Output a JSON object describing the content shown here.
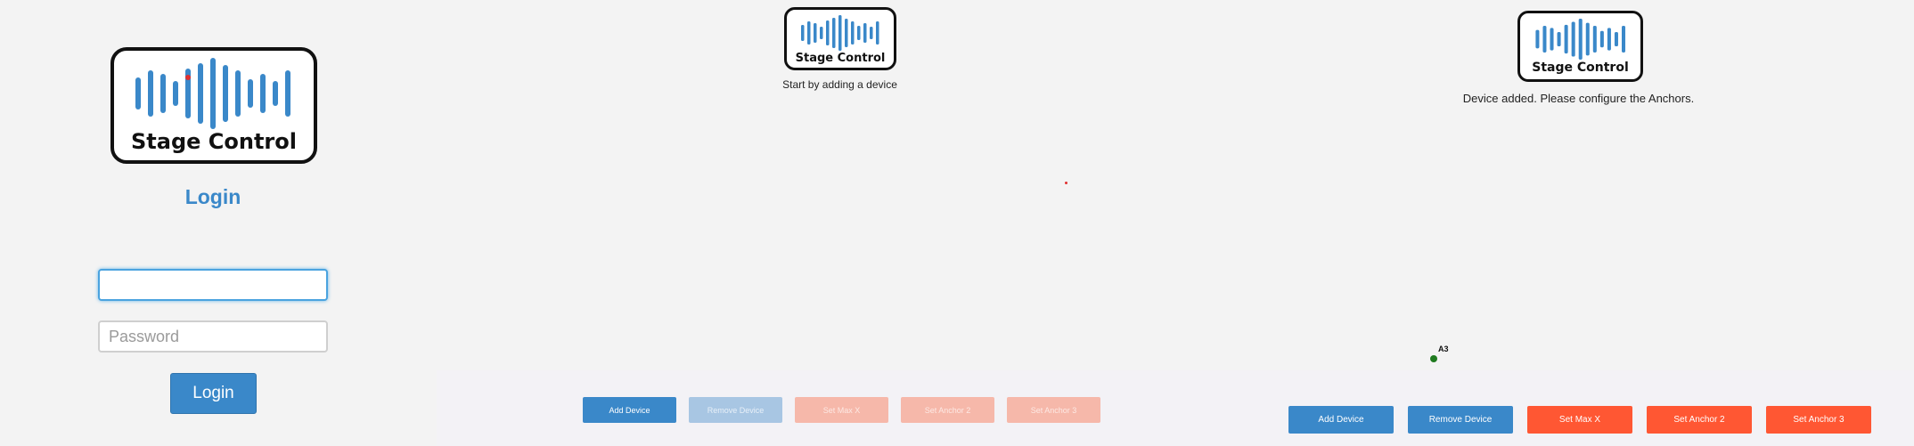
{
  "logo": {
    "text": "Stage Control"
  },
  "login": {
    "title": "Login",
    "username_value": "",
    "password_placeholder": "Password",
    "button_label": "Login"
  },
  "start": {
    "message": "Start by adding a device",
    "buttons": {
      "add": "Add Device",
      "remove": "Remove Device",
      "max_x": "Set Max X",
      "anchor2": "Set Anchor 2",
      "anchor3": "Set Anchor 3"
    }
  },
  "added": {
    "message": "Device added. Please configure the Anchors.",
    "device_label": "A3",
    "buttons": {
      "add": "Add Device",
      "remove": "Remove Device",
      "max_x": "Set Max X",
      "anchor2": "Set Anchor 2",
      "anchor3": "Set Anchor 3"
    }
  },
  "colors": {
    "primary_blue": "#3a88c9",
    "accent_red": "#ff5733",
    "device_green": "#1f7a1f"
  }
}
